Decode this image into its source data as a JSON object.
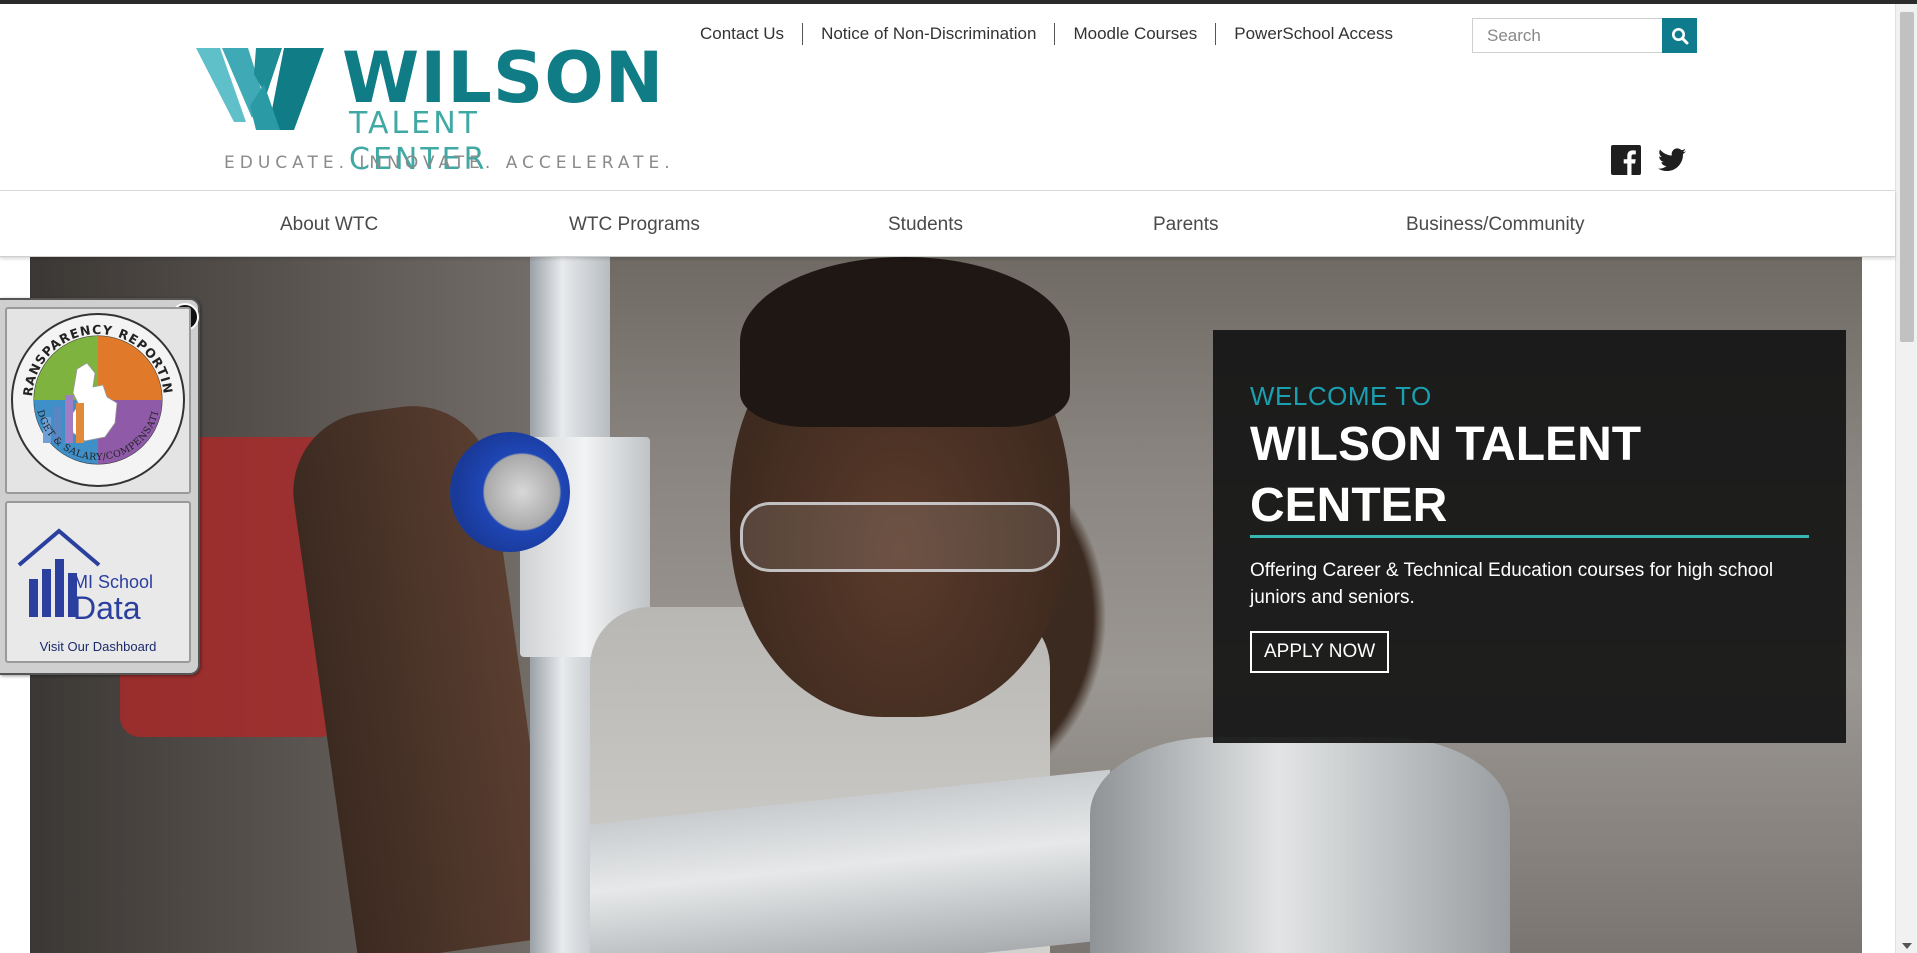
{
  "brand": {
    "name_line1": "WILSON",
    "name_line2": "TALENT CENTER",
    "tagline": "EDUCATE. INNOVATE. ACCELERATE.",
    "colors": {
      "primary": "#0f7c86",
      "secondary": "#40a9a4",
      "accent": "#38b6b4",
      "welcome_to": "#1a9fb0"
    }
  },
  "utility_nav": {
    "items": [
      {
        "label": "Contact Us"
      },
      {
        "label": "Notice of Non-Discrimination"
      },
      {
        "label": "Moodle Courses"
      },
      {
        "label": "PowerSchool Access"
      }
    ]
  },
  "search": {
    "placeholder": "Search",
    "button_icon": "search-icon"
  },
  "social": {
    "icons": [
      "facebook-icon",
      "twitter-icon"
    ]
  },
  "main_nav": {
    "items": [
      {
        "label": "About WTC"
      },
      {
        "label": "WTC Programs"
      },
      {
        "label": "Students"
      },
      {
        "label": "Parents"
      },
      {
        "label": "Business/Community"
      }
    ]
  },
  "hero": {
    "welcome_to": "WELCOME TO",
    "title": "WILSON TALENT CENTER",
    "description": "Offering Career & Technical Education courses for high school juniors and seniors.",
    "cta": "APPLY NOW"
  },
  "side_widget": {
    "close_icon": "close-icon",
    "tile1": {
      "ring_text_top": "TRANSPARENCY REPORTING",
      "ring_text_bottom": "BUDGET & SALARY/COMPENSATION"
    },
    "tile2": {
      "line1": "MI School",
      "line2": "Data",
      "caption": "Visit Our Dashboard"
    }
  }
}
